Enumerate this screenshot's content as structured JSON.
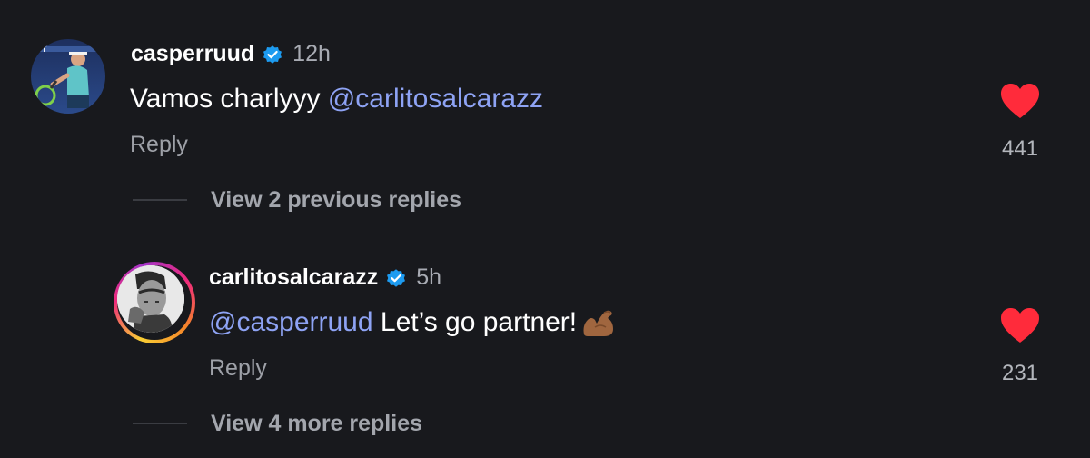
{
  "comment": {
    "username": "casperruud",
    "time": "12h",
    "text_before": "Vamos charlyyy ",
    "mention": "@carlitosalcarazz",
    "reply_label": "Reply",
    "like_count": "441",
    "avatar_icon": "casperruud-avatar-photo"
  },
  "previous_replies_label": "View 2 previous replies",
  "reply": {
    "username": "carlitosalcarazz",
    "time": "5h",
    "mention": "@casperruud",
    "text_after": " Let’s go partner!",
    "emoji_icon": "flexed-biceps-icon",
    "reply_label": "Reply",
    "like_count": "231",
    "avatar_icon": "carlitosalcarazz-avatar-photo"
  },
  "more_replies_label": "View 4 more replies",
  "colors": {
    "background": "#18191d",
    "mention": "#8ea3f4",
    "heart": "#ff2b3b",
    "verified": "#1d9bf0"
  }
}
